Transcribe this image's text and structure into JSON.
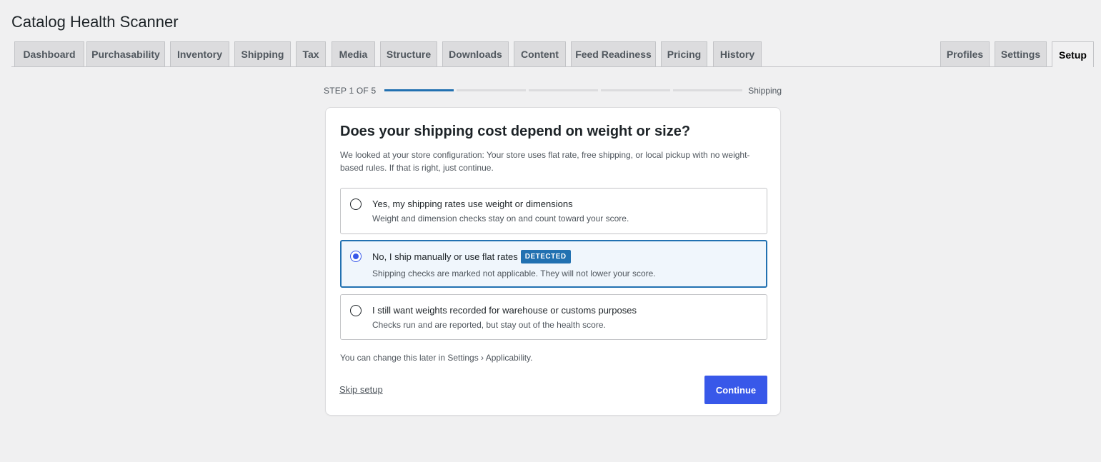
{
  "app": {
    "title": "Catalog Health Scanner"
  },
  "tabs": {
    "left": [
      {
        "label": "Dashboard"
      },
      {
        "label": "Purchasability"
      },
      {
        "label": "Inventory"
      },
      {
        "label": "Shipping"
      },
      {
        "label": "Tax"
      },
      {
        "label": "Media"
      },
      {
        "label": "Structure"
      },
      {
        "label": "Downloads"
      },
      {
        "label": "Content"
      },
      {
        "label": "Feed Readiness"
      },
      {
        "label": "Pricing"
      },
      {
        "label": "History"
      }
    ],
    "right": [
      {
        "label": "Profiles"
      },
      {
        "label": "Settings"
      },
      {
        "label": "Setup",
        "active": true
      }
    ]
  },
  "stepper": {
    "label": "STEP 1 OF 5",
    "current_step": 1,
    "total_steps": 5,
    "step_name": "Shipping"
  },
  "question": {
    "title": "Does your shipping cost depend on weight or size?",
    "description": "We looked at your store configuration: Your store uses flat rate, free shipping, or local pickup with no weight-based rules. If that is right, just continue."
  },
  "options": [
    {
      "label": "Yes, my shipping rates use weight or dimensions",
      "description": "Weight and dimension checks stay on and count toward your score.",
      "selected": false
    },
    {
      "label": "No, I ship manually or use flat rates",
      "badge": "DETECTED",
      "description": "Shipping checks are marked not applicable. They will not lower your score.",
      "selected": true
    },
    {
      "label": "I still want weights recorded for warehouse or customs purposes",
      "description": "Checks run and are reported, but stay out of the health score.",
      "selected": false
    }
  ],
  "note": "You can change this later in Settings › Applicability.",
  "actions": {
    "skip_label": "Skip setup",
    "continue_label": "Continue"
  },
  "colors": {
    "accent": "#2271b1",
    "primary_button": "#3858e9",
    "selected_bg": "#f0f6fc",
    "page_bg": "#f0f0f1"
  }
}
